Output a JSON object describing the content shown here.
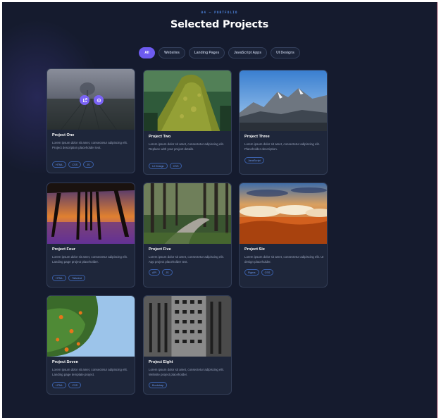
{
  "header": {
    "eyebrow": "04 — PORTFOLIO",
    "title": "Selected Projects"
  },
  "filters": [
    {
      "label": "All",
      "active": true
    },
    {
      "label": "Websites",
      "active": false
    },
    {
      "label": "Landing Pages",
      "active": false
    },
    {
      "label": "JavaScript Apps",
      "active": false
    },
    {
      "label": "UI Designs",
      "active": false
    }
  ],
  "projects": [
    {
      "name": "Project One",
      "desc": "Lorem ipsum dolor sit amet, consectetur adipiscing elit. Project description placeholder text.",
      "tags": [
        "HTML",
        "CSS",
        "JS"
      ],
      "image": "misty-field"
    },
    {
      "name": "Project Two",
      "desc": "Lorem ipsum dolor sit amet, consectetur adipiscing elit. Replace with your project details.",
      "tags": [
        "UI Design",
        "CSS"
      ],
      "image": "mossy-tree"
    },
    {
      "name": "Project Three",
      "desc": "Lorem ipsum dolor sit amet, consectetur adipiscing elit. Placeholder description.",
      "tags": [
        "JavaScript"
      ],
      "image": "snowy-mountains"
    },
    {
      "name": "Project Four",
      "desc": "Lorem ipsum dolor sit amet, consectetur adipiscing elit. Landing page project placeholder.",
      "tags": [
        "HTML",
        "Tailwind"
      ],
      "image": "pier-sunset"
    },
    {
      "name": "Project Five",
      "desc": "Lorem ipsum dolor sit amet, consectetur adipiscing elit. App project placeholder text.",
      "tags": [
        "API",
        "JS"
      ],
      "image": "forest-path"
    },
    {
      "name": "Project Six",
      "desc": "Lorem ipsum dolor sit amet, consectetur adipiscing elit. UI design placeholder.",
      "tags": [
        "Figma",
        "CSS"
      ],
      "image": "clouds-sunset"
    },
    {
      "name": "Project Seven",
      "desc": "Lorem ipsum dolor sit amet, consectetur adipiscing elit. Landing page template project.",
      "tags": [
        "HTML",
        "CSS"
      ],
      "image": "orange-tree"
    },
    {
      "name": "Project Eight",
      "desc": "Lorem ipsum dolor sit amet, consectetur adipiscing elit. Website project placeholder.",
      "tags": [
        "Bootstrap"
      ],
      "image": "city-building"
    }
  ],
  "overlay": {
    "icons": [
      "external-link-icon",
      "github-icon"
    ]
  }
}
